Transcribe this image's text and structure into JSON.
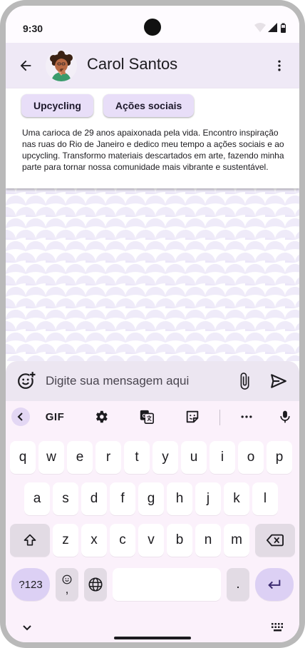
{
  "status_bar": {
    "time": "9:30"
  },
  "header": {
    "contact_name": "Carol Santos",
    "back_icon": "arrow-back-icon",
    "menu_icon": "more-vert-icon"
  },
  "profile": {
    "tags": [
      "Upcycling",
      "Ações sociais"
    ],
    "bio": "Uma carioca de 29 anos apaixonada pela vida. Encontro inspiração nas ruas do Rio de Janeiro e dedico meu tempo a ações sociais e ao upcycling. Transformo materiais descartados em arte, fazendo minha parte para tornar nossa comunidade mais vibrante e sustentável."
  },
  "composer": {
    "placeholder": "Digite sua mensagem aqui",
    "value": ""
  },
  "keyboard": {
    "toolbar": {
      "gif_label": "GIF"
    },
    "rows": [
      [
        "q",
        "w",
        "e",
        "r",
        "t",
        "y",
        "u",
        "i",
        "o",
        "p"
      ],
      [
        "a",
        "s",
        "d",
        "f",
        "g",
        "h",
        "j",
        "k",
        "l"
      ],
      [
        "z",
        "x",
        "c",
        "v",
        "b",
        "n",
        "m"
      ]
    ],
    "symbols_label": "?123",
    "comma_label": ",",
    "period_label": "."
  },
  "colors": {
    "app_bar": "#efe9f6",
    "chip": "#e8def8",
    "keyboard": "#fbf1fb",
    "accent": "#dcd0f4",
    "pattern": "#ebe6f8"
  }
}
